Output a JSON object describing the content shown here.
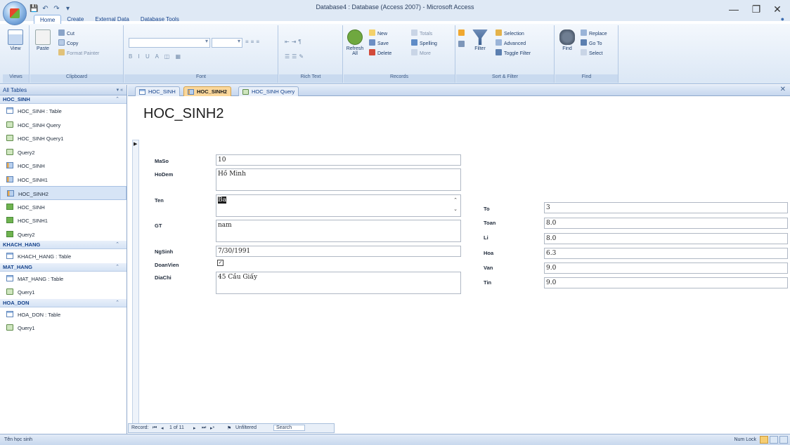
{
  "window": {
    "title": "Database4 : Database (Access 2007) - Microsoft Access",
    "minimize": "—",
    "restore": "❐",
    "close": "✕"
  },
  "ribbon": {
    "tabs": [
      "Home",
      "Create",
      "External Data",
      "Database Tools"
    ],
    "groups": {
      "views": {
        "label": "Views",
        "view_btn": "View"
      },
      "clipboard": {
        "label": "Clipboard",
        "paste": "Paste",
        "cut": "Cut",
        "copy": "Copy",
        "format_painter": "Format Painter"
      },
      "font": {
        "label": "Font",
        "format_row": "B I U A ◫ ▦"
      },
      "rich_text": {
        "label": "Rich Text"
      },
      "records": {
        "label": "Records",
        "refresh": "Refresh All",
        "new": "New",
        "save": "Save",
        "delete": "Delete",
        "totals": "Totals",
        "spelling": "Spelling",
        "more": "More"
      },
      "sort_filter": {
        "label": "Sort & Filter",
        "filter": "Filter",
        "selection": "Selection",
        "advanced": "Advanced",
        "toggle_filter": "Toggle Filter"
      },
      "find": {
        "label": "Find",
        "find": "Find",
        "replace": "Replace",
        "goto": "Go To",
        "select": "Select"
      }
    }
  },
  "nav": {
    "header": "All Tables",
    "groups": [
      {
        "name": "HOC_SINH",
        "items": [
          {
            "label": "HOC_SINH : Table",
            "type": "table"
          },
          {
            "label": "HOC_SINH Query",
            "type": "query"
          },
          {
            "label": "HOC_SINH Query1",
            "type": "query"
          },
          {
            "label": "Query2",
            "type": "query"
          },
          {
            "label": "HOC_SINH",
            "type": "formtab"
          },
          {
            "label": "HOC_SINH1",
            "type": "formtab"
          },
          {
            "label": "HOC_SINH2",
            "type": "formtab",
            "selected": true
          },
          {
            "label": "HOC_SINH",
            "type": "form"
          },
          {
            "label": "HOC_SINH1",
            "type": "form"
          },
          {
            "label": "Query2",
            "type": "form"
          }
        ]
      },
      {
        "name": "KHACH_HANG",
        "items": [
          {
            "label": "KHACH_HANG : Table",
            "type": "table"
          }
        ]
      },
      {
        "name": "MAT_HANG",
        "items": [
          {
            "label": "MAT_HANG : Table",
            "type": "table"
          },
          {
            "label": "Query1",
            "type": "query"
          }
        ]
      },
      {
        "name": "HOA_DON",
        "items": [
          {
            "label": "HOA_DON : Table",
            "type": "table"
          },
          {
            "label": "Query1",
            "type": "query"
          }
        ]
      }
    ]
  },
  "doc_tabs": [
    {
      "label": "HOC_SINH",
      "type": "table"
    },
    {
      "label": "HOC_SINH2",
      "type": "formtab",
      "active": true
    },
    {
      "label": "HOC_SINH Query",
      "type": "query"
    }
  ],
  "form": {
    "title": "HOC_SINH2",
    "left_fields": {
      "maso": {
        "label": "MaSo",
        "value": "10"
      },
      "hodem": {
        "label": "HoDem",
        "value": "Hồ Minh"
      },
      "ten": {
        "label": "Ten",
        "value": "Ba"
      },
      "gt": {
        "label": "GT",
        "value": "nam"
      },
      "ngsinh": {
        "label": "NgSinh",
        "value": "7/30/1991"
      },
      "doanvien": {
        "label": "DoanVien",
        "checked": true
      },
      "diachi": {
        "label": "DiaChi",
        "value": "45 Cầu Giấy"
      }
    },
    "right_fields": {
      "to": {
        "label": "To",
        "value": "3"
      },
      "toan": {
        "label": "Toan",
        "value": "8.0"
      },
      "li": {
        "label": "Li",
        "value": "8.0"
      },
      "hoa": {
        "label": "Hoa",
        "value": "6.3"
      },
      "van": {
        "label": "Van",
        "value": "9.0"
      },
      "tin": {
        "label": "Tin",
        "value": "9.0"
      }
    }
  },
  "record_nav": {
    "label": "Record:",
    "position": "1 of 11",
    "filter": "Unfiltered",
    "search": "Search"
  },
  "status": {
    "left": "Tên học sinh",
    "numlock": "Num Lock"
  }
}
